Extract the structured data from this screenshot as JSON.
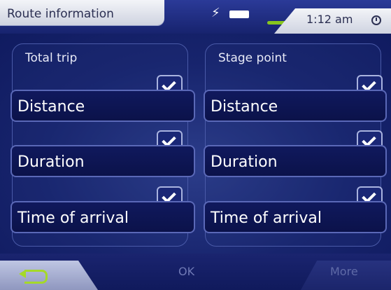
{
  "title": "Route information",
  "status": {
    "time": "1:12 am"
  },
  "columns": [
    {
      "header": "Total trip",
      "items": [
        "Distance",
        "Duration",
        "Time of arrival"
      ],
      "checked": [
        true,
        true,
        true
      ]
    },
    {
      "header": "Stage point",
      "items": [
        "Distance",
        "Duration",
        "Time of arrival"
      ],
      "checked": [
        true,
        true,
        true
      ]
    }
  ],
  "buttons": {
    "ok": "OK",
    "more": "More"
  },
  "icons": {
    "back": "back-arrow-icon",
    "power": "power-icon",
    "battery": "battery-icon",
    "clock": "clock-icon",
    "check": "checkmark-icon"
  },
  "colors": {
    "accent": "#87c51e",
    "panel": "#17236e"
  }
}
